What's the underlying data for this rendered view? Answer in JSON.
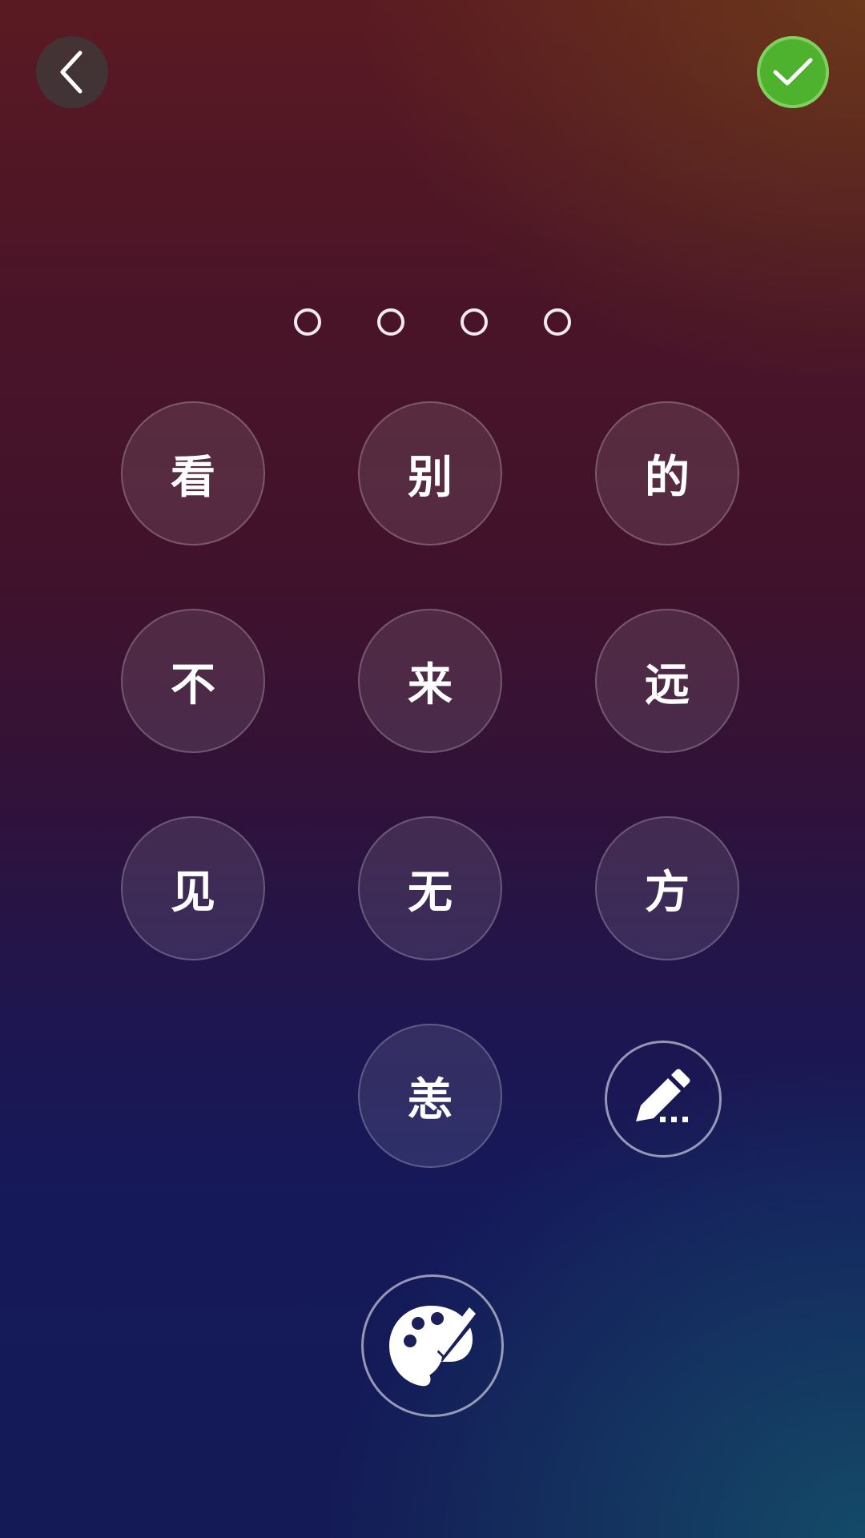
{
  "header": {
    "back_icon": "chevron-left-icon",
    "confirm_icon": "checkmark-icon",
    "confirm_color": "#4eb22e"
  },
  "passcode": {
    "length": 4,
    "filled": 0
  },
  "keys": [
    "看",
    "别",
    "的",
    "不",
    "来",
    "远",
    "见",
    "无",
    "方",
    "恙"
  ],
  "actions": {
    "edit_icon": "pencil-icon",
    "theme_icon": "palette-icon"
  }
}
